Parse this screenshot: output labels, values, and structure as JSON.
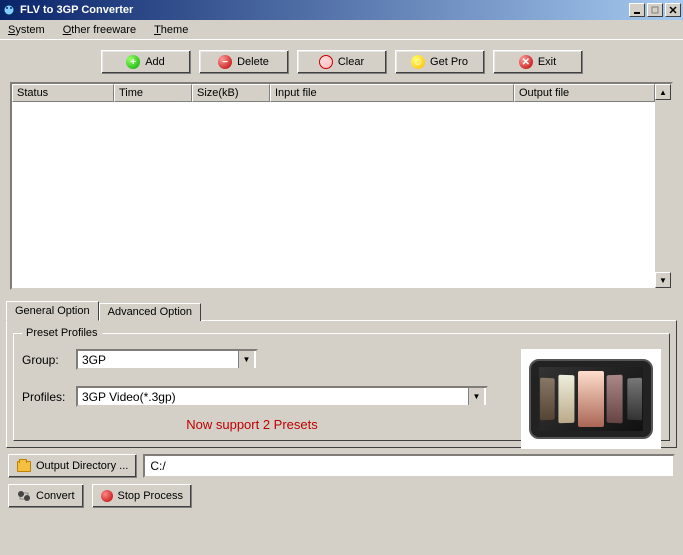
{
  "window": {
    "title": "FLV to 3GP Converter"
  },
  "menu": {
    "system": "System",
    "other": "Other freeware",
    "theme": "Theme"
  },
  "toolbar": {
    "add": "Add",
    "delete": "Delete",
    "clear": "Clear",
    "getpro": "Get Pro",
    "exit": "Exit"
  },
  "table": {
    "headers": {
      "status": "Status",
      "time": "Time",
      "size": "Size(kB)",
      "input": "Input file",
      "output": "Output file"
    },
    "rows": []
  },
  "tabs": {
    "general": "General Option",
    "advanced": "Advanced Option"
  },
  "preset": {
    "legend": "Preset Profiles",
    "group_label": "Group:",
    "group_value": "3GP",
    "profiles_label": "Profiles:",
    "profiles_value": "3GP Video(*.3gp)",
    "support_msg": "Now support 2 Presets"
  },
  "output": {
    "button": "Output Directory ...",
    "path": "C:/"
  },
  "bottom": {
    "convert": "Convert",
    "stop": "Stop Process"
  }
}
